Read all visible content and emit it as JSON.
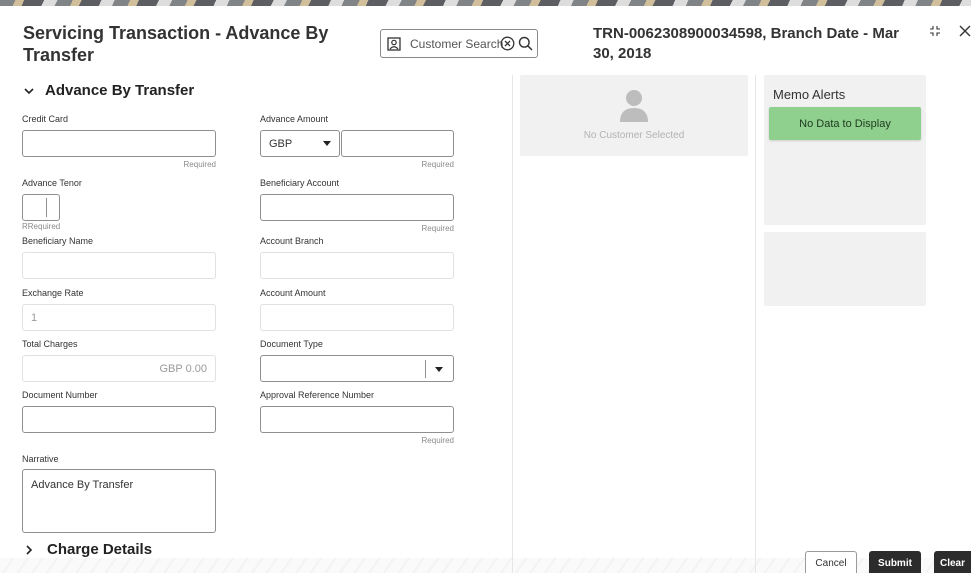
{
  "header": {
    "title": "Servicing Transaction - Advance By Transfer",
    "search_placeholder": "Customer Search",
    "trn": "TRN-0062308900034598, Branch Date - Mar 30, 2018"
  },
  "section": {
    "title": "Advance By Transfer",
    "collapsed_title": "Charge Details"
  },
  "fields": {
    "credit_card": {
      "label": "Credit Card",
      "value": "",
      "hint": "Required"
    },
    "advance_amount": {
      "label": "Advance Amount",
      "currency": "GBP",
      "value": "",
      "hint": "Required"
    },
    "advance_tenor": {
      "label": "Advance Tenor",
      "value": "",
      "hint": "RRequired"
    },
    "beneficiary_account": {
      "label": "Beneficiary Account",
      "value": "",
      "hint": "Required"
    },
    "beneficiary_name": {
      "label": "Beneficiary Name",
      "value": ""
    },
    "account_branch": {
      "label": "Account Branch",
      "value": ""
    },
    "exchange_rate": {
      "label": "Exchange Rate",
      "value": "1"
    },
    "account_amount": {
      "label": "Account Amount",
      "value": ""
    },
    "total_charges": {
      "label": "Total Charges",
      "value": "GBP 0.00"
    },
    "document_type": {
      "label": "Document Type",
      "value": ""
    },
    "document_number": {
      "label": "Document Number",
      "value": ""
    },
    "approval_reference_number": {
      "label": "Approval Reference Number",
      "value": "",
      "hint": "Required"
    },
    "narrative": {
      "label": "Narrative",
      "value": "Advance By Transfer"
    }
  },
  "customer_panel": {
    "empty_text": "No Customer Selected"
  },
  "memo": {
    "title": "Memo Alerts",
    "empty_text": "No Data to Display"
  },
  "buttons": {
    "cancel": "Cancel",
    "submit": "Submit",
    "clear": "Clear"
  },
  "colors": {
    "memo_empty_bg": "#8fd08f",
    "primary_button": "#2c2c2c"
  },
  "icons": [
    "user-search-icon",
    "clear-circle-icon",
    "search-icon",
    "minimize-icon",
    "close-icon",
    "chevron-down-icon",
    "chevron-right-icon",
    "dropdown-caret-icon",
    "customer-avatar-icon"
  ]
}
